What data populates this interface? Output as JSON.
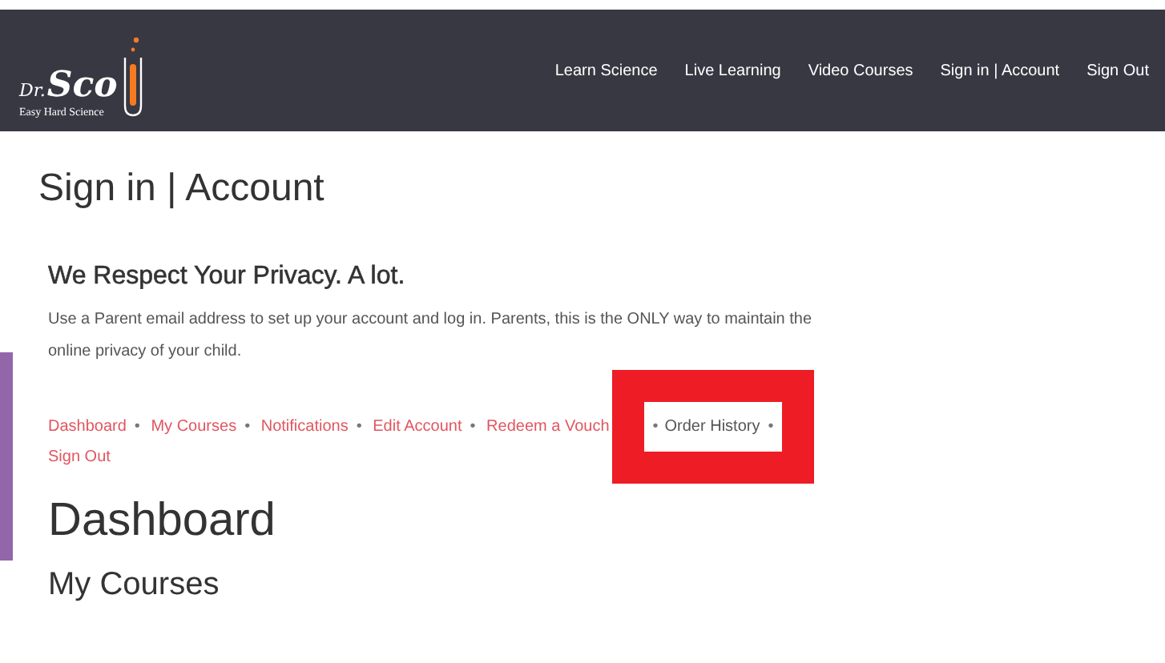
{
  "logo": {
    "script": "Dr.",
    "name": "Sco",
    "tagline": "Easy Hard Science"
  },
  "nav": [
    {
      "label": "Learn Science"
    },
    {
      "label": "Live Learning"
    },
    {
      "label": "Video Courses"
    },
    {
      "label": "Sign in | Account"
    },
    {
      "label": "Sign Out"
    }
  ],
  "page_title": "Sign in | Account",
  "privacy": {
    "heading": "We Respect Your Privacy. A lot.",
    "text": "Use a Parent email address to set up your account and log in. Parents, this is the ONLY way to maintain the online privacy of your child."
  },
  "account_nav": [
    {
      "label": "Dashboard",
      "separator": "•",
      "selected": false,
      "highlighted": false
    },
    {
      "label": "My Courses",
      "separator": "•",
      "selected": false,
      "highlighted": false
    },
    {
      "label": "Notifications",
      "separator": "•",
      "selected": false,
      "highlighted": false
    },
    {
      "label": "Edit Account",
      "separator": "•",
      "selected": false,
      "highlighted": false
    },
    {
      "label": "Redeem a Vouch",
      "separator": "•",
      "selected": false,
      "highlighted": false
    },
    {
      "label": "Order History",
      "separator": "•",
      "selected": true,
      "highlighted": true
    },
    {
      "label": "Sign Out",
      "selected": false,
      "highlighted": false
    }
  ],
  "section_heading": "Dashboard",
  "subsection_heading": "My Courses"
}
